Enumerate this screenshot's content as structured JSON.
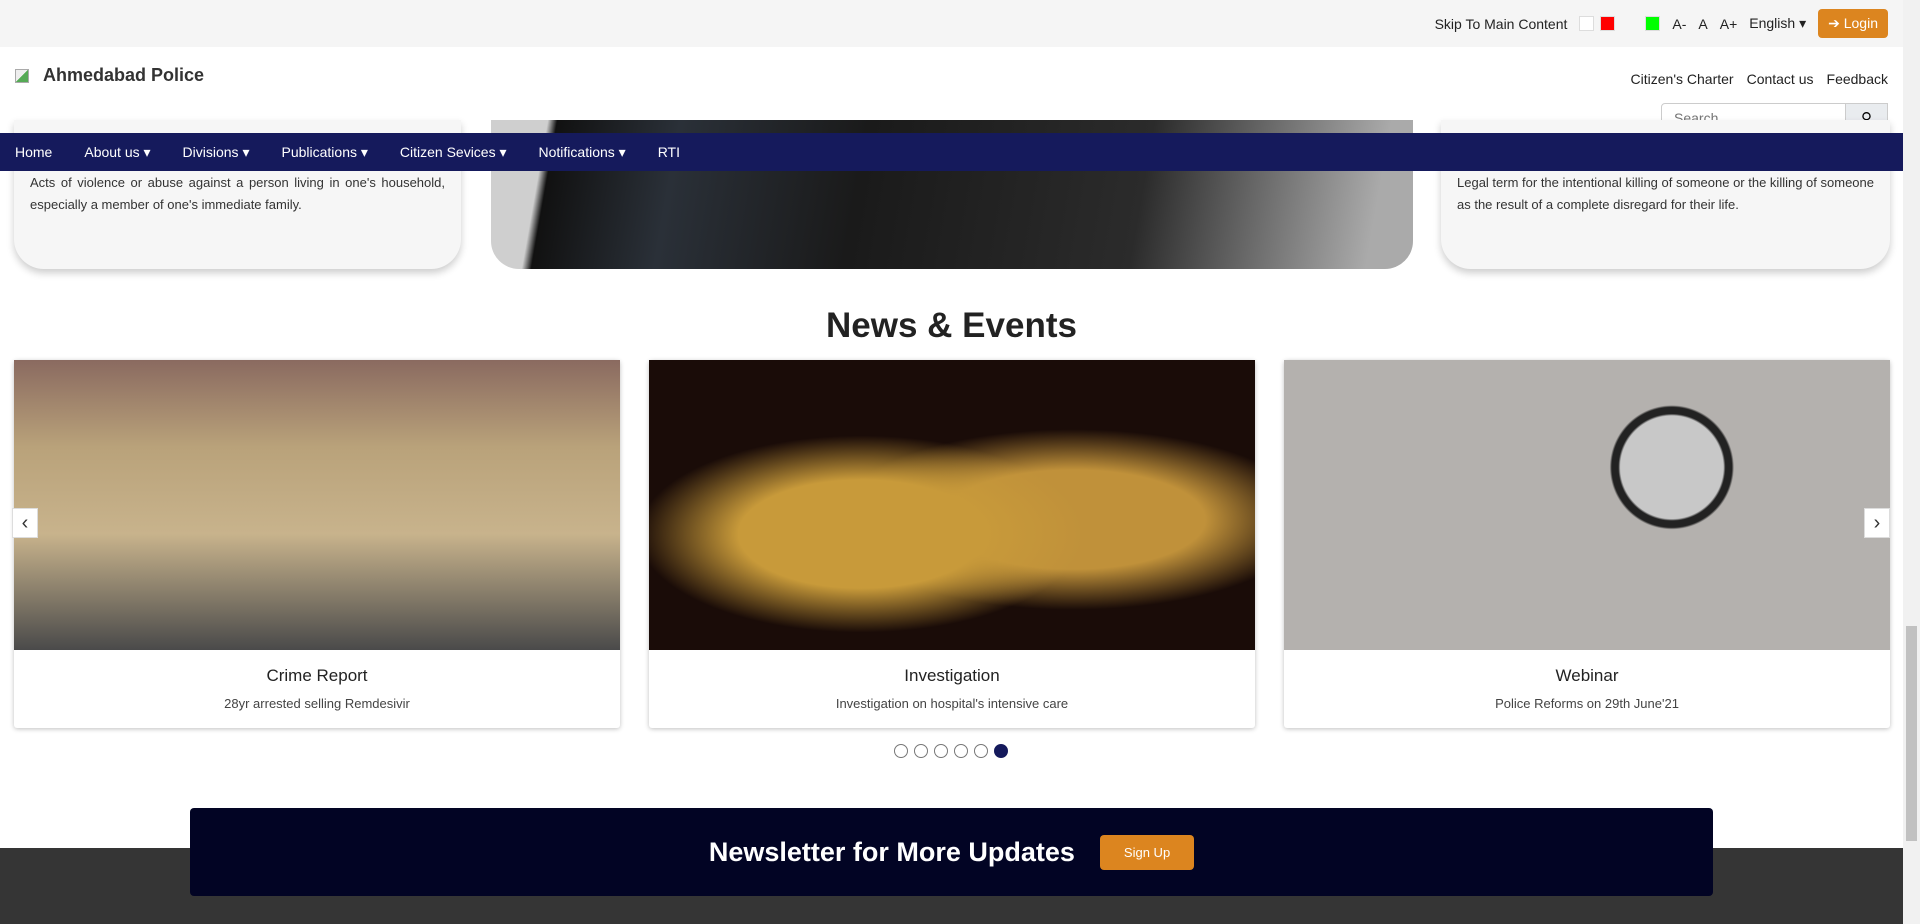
{
  "topbar": {
    "skip": "Skip To Main Content",
    "font_small": "A-",
    "font_normal": "A",
    "font_large": "A+",
    "language": "English",
    "login": "Login",
    "colors": [
      "#ffffff",
      "#ff0000",
      "#00ff00"
    ]
  },
  "header": {
    "title": "Ahmedabad Police",
    "links": [
      "Citizen's Charter",
      "Contact us",
      "Feedback"
    ],
    "search_placeholder": "Search"
  },
  "nav": [
    "Home",
    "About us ▾",
    "Divisions ▾",
    "Publications ▾",
    "Citizen Sevices ▾",
    "Notifications ▾",
    "RTI"
  ],
  "cards": {
    "left": "Acts of violence or abuse against a person living in one's household, especially a member of one's immediate family.",
    "right": "Legal term for the intentional killing of someone or the killing of someone as the result of a complete disregard for their life."
  },
  "news": {
    "heading": "News & Events",
    "items": [
      {
        "title": "Crime Report",
        "subtitle": "28yr arrested selling Remdesivir"
      },
      {
        "title": "Investigation",
        "subtitle": "Investigation on hospital's intensive care"
      },
      {
        "title": "Webinar",
        "subtitle": "Police Reforms on 29th June'21"
      }
    ],
    "active_dot": 6,
    "dot_count": 6
  },
  "newsletter": {
    "title": "Newsletter for More Updates",
    "button": "Sign Up"
  }
}
